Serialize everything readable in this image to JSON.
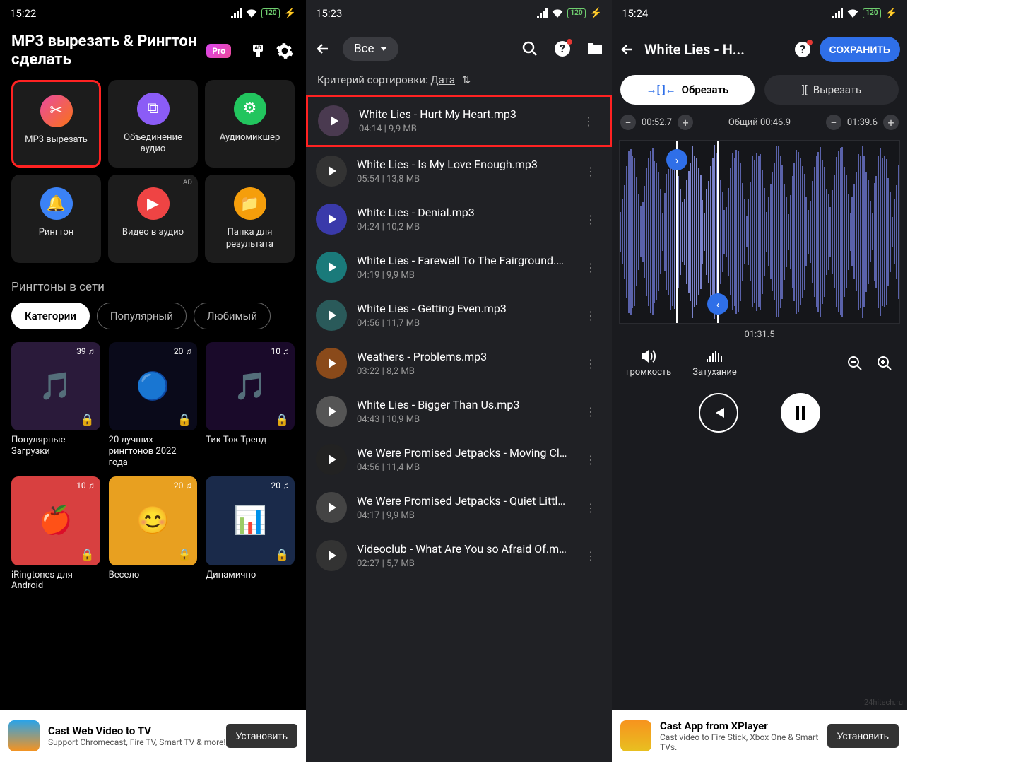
{
  "screen1": {
    "time": "15:22",
    "battery": "120",
    "title": "MP3 вырезать & Рингтон сделать",
    "pro": "Pro",
    "cards": [
      {
        "label": "MP3 вырезать",
        "color": "linear-gradient(135deg,#e94aa1,#f97316)",
        "hl": true
      },
      {
        "label": "Объединение аудио",
        "color": "#8b5cf6"
      },
      {
        "label": "Аудиомикшер",
        "color": "#22c55e"
      },
      {
        "label": "Рингтон",
        "color": "#3b82f6"
      },
      {
        "label": "Видео в аудио",
        "color": "#ef4444",
        "ad": "AD"
      },
      {
        "label": "Папка для результата",
        "color": "#f59e0b"
      }
    ],
    "section_title": "Рингтоны в сети",
    "pills": [
      {
        "label": "Категории",
        "active": true
      },
      {
        "label": "Популярный"
      },
      {
        "label": "Любимый"
      }
    ],
    "rings": [
      {
        "count": "39 ♫",
        "title": "Популярные Загрузки",
        "bg": "#2a1a3a"
      },
      {
        "count": "20 ♫",
        "title": "20 лучших рингтонов 2022 года",
        "bg": "#0a0a1a"
      },
      {
        "count": "10 ♫",
        "title": "Тик Ток Тренд",
        "bg": "#1a0a2a"
      },
      {
        "count": "10 ♫",
        "title": "iRingtones для Android",
        "bg": "#d84040"
      },
      {
        "count": "20 ♫",
        "title": "Весело",
        "bg": "#e8a020"
      },
      {
        "count": "20 ♫",
        "title": "Динамично",
        "bg": "#1a2a4a"
      }
    ],
    "ad": {
      "title": "Cast Web Video to TV",
      "sub": "Support Chromecast, Fire TV, Smart TV & more!",
      "btn": "Установить"
    }
  },
  "screen2": {
    "time": "15:23",
    "battery": "120",
    "dropdown": "Все",
    "sort_label": "Критерий сортировки:",
    "sort_value": "Дата",
    "songs": [
      {
        "title": "White Lies - Hurt My Heart.mp3",
        "meta": "04:14 | 9,9 MB",
        "hl": true,
        "bg": "#4a3a50"
      },
      {
        "title": "White Lies - Is My Love Enough.mp3",
        "meta": "05:54 | 13,8 MB",
        "bg": "#333"
      },
      {
        "title": "White Lies - Denial.mp3",
        "meta": "04:24 | 10,2 MB",
        "bg": "#3a3aaa"
      },
      {
        "title": "White Lies - Farewell To The Fairground.m...",
        "meta": "04:19 | 9,9 MB",
        "bg": "#1a7a7a"
      },
      {
        "title": "White Lies - Getting Even.mp3",
        "meta": "04:56 | 11,7 MB",
        "bg": "#2a5a5a"
      },
      {
        "title": "Weathers - Problems.mp3",
        "meta": "03:22 | 8,2 MB",
        "bg": "#8a4a1a"
      },
      {
        "title": "White Lies - Bigger Than Us.mp3",
        "meta": "04:43 | 10,9 MB",
        "bg": "#555"
      },
      {
        "title": "We Were Promised Jetpacks - Moving Clo...",
        "meta": "04:56 | 11,4 MB",
        "bg": "#222"
      },
      {
        "title": "We Were Promised Jetpacks - Quiet Little...",
        "meta": "04:17 | 9,9 MB",
        "bg": "#444"
      },
      {
        "title": "Videoclub - What Are You so Afraid Of.mp3",
        "meta": "02:27 | 5,7 MB",
        "bg": "#333"
      }
    ]
  },
  "screen3": {
    "time": "15:24",
    "battery": "120",
    "title": "White Lies - H...",
    "save": "СОХРАНИТЬ",
    "mode_cut": "Обрезать",
    "mode_trim": "Вырезать",
    "start": "00:52.7",
    "end": "01:39.6",
    "total_label": "Общий",
    "total": "00:46.9",
    "current": "01:31.5",
    "volume": "громкость",
    "fade": "Затухание",
    "ad": {
      "title": "Cast App from XPlayer",
      "sub": "Cast video to Fire Stick, Xbox One & Smart TVs.",
      "btn": "Установить"
    }
  },
  "watermark": "24hitech.ru"
}
